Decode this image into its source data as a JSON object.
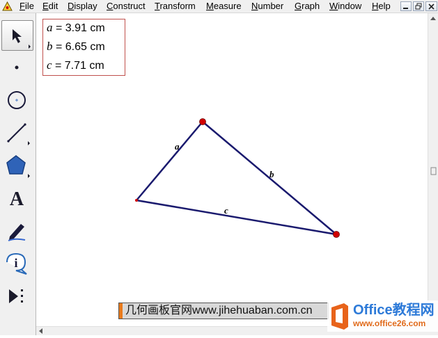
{
  "menu": {
    "items": [
      {
        "key": "F",
        "rest": "ile"
      },
      {
        "key": "E",
        "rest": "dit"
      },
      {
        "key": "D",
        "rest": "isplay"
      },
      {
        "key": "C",
        "rest": "onstruct"
      },
      {
        "key": "T",
        "rest": "ransform"
      },
      {
        "key": "M",
        "rest": "easure"
      },
      {
        "key": "N",
        "rest": "umber"
      },
      {
        "key": "G",
        "rest": "raph"
      },
      {
        "key": "W",
        "rest": "indow"
      },
      {
        "key": "H",
        "rest": "elp"
      }
    ]
  },
  "tools": {
    "text_tool_glyph": "A",
    "info_tool_glyph": "i"
  },
  "measurements": [
    {
      "var": "a",
      "text": " = 3.91 cm"
    },
    {
      "var": "b",
      "text": " = 6.65 cm"
    },
    {
      "var": "c",
      "text": " = 7.71 cm"
    }
  ],
  "triangle": {
    "side_labels": [
      "a",
      "b",
      "c"
    ],
    "stroke_color": "#1a1a6e",
    "point_color": "#d10000"
  },
  "watermark": {
    "text": "几何画板官网www.jihehuaban.com.cn"
  },
  "logo": {
    "title": "Office教程网",
    "url": "www.office26.com"
  }
}
